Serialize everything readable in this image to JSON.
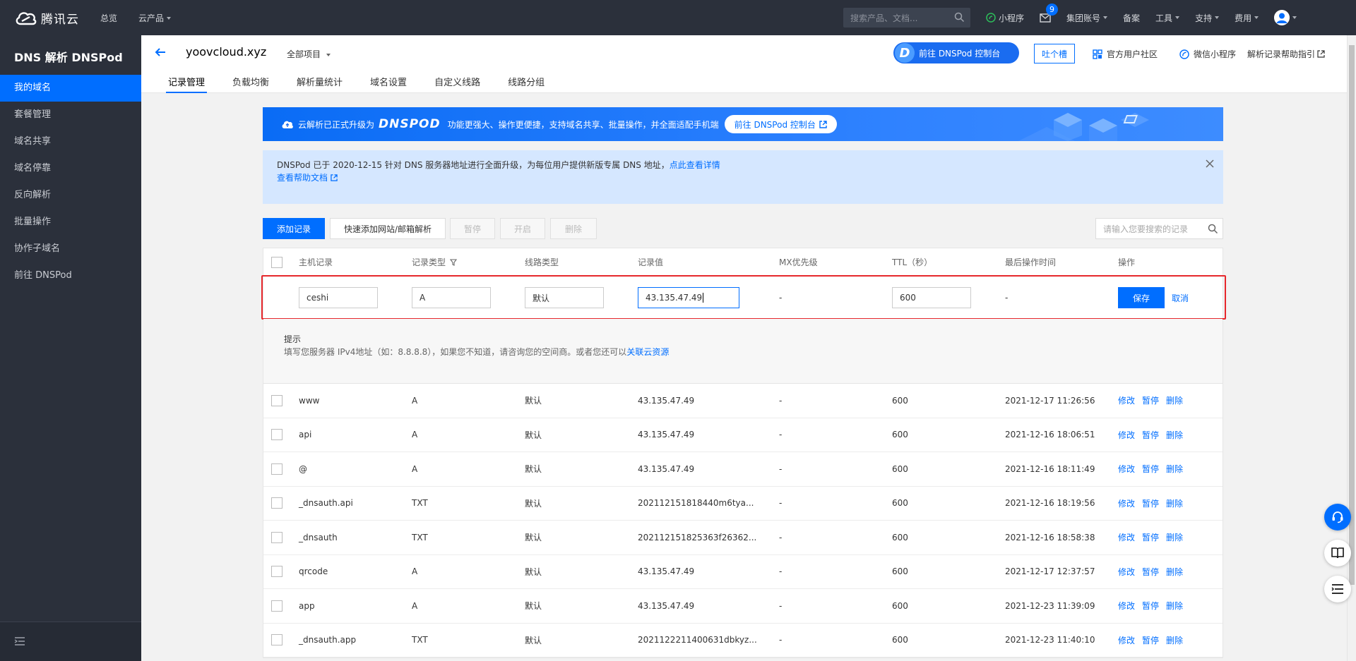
{
  "topnav": {
    "brand": "腾讯云",
    "overview": "总览",
    "products": "云产品",
    "search_placeholder": "搜索产品、文档...",
    "miniprogram": "小程序",
    "message_count": "9",
    "group_account": "集团账号",
    "beian": "备案",
    "tools": "工具",
    "support": "支持",
    "billing": "费用"
  },
  "sidebar": {
    "title": "DNS 解析 DNSPod",
    "items": [
      {
        "label": "我的域名"
      },
      {
        "label": "套餐管理"
      },
      {
        "label": "域名共享"
      },
      {
        "label": "域名停靠"
      },
      {
        "label": "反向解析"
      },
      {
        "label": "批量操作"
      },
      {
        "label": "协作子域名"
      },
      {
        "label": "前往 DNSPod"
      }
    ]
  },
  "header": {
    "domain": "yoovcloud.xyz",
    "project": "全部项目",
    "dnspod_console": "前往 DNSPod 控制台",
    "tucao": "吐个槽",
    "community": "官方用户社区",
    "wechat_mini": "微信小程序",
    "help_guide": "解析记录帮助指引",
    "tabs": [
      {
        "label": "记录管理"
      },
      {
        "label": "负载均衡"
      },
      {
        "label": "解析量统计"
      },
      {
        "label": "域名设置"
      },
      {
        "label": "自定义线路"
      },
      {
        "label": "线路分组"
      }
    ]
  },
  "banner": {
    "text1": "云解析已正式升级为",
    "brand": "DNSPOD",
    "text2": "功能更强大、操作更便捷，支持域名共享、批量操作，并全面适配手机端",
    "button": "前往 DNSPod 控制台"
  },
  "notice": {
    "text": "DNSPod 已于 2020-12-15 针对 DNS 服务器地址进行全面升级，为每位用户提供新版专属 DNS 地址，",
    "link": "点此查看详情",
    "help": "查看帮助文档"
  },
  "toolbar": {
    "add_record": "添加记录",
    "quick_add": "快速添加网站/邮箱解析",
    "pause": "暂停",
    "enable": "开启",
    "delete": "删除",
    "search_placeholder": "请输入您要搜索的记录"
  },
  "table": {
    "columns": [
      "主机记录",
      "记录类型",
      "线路类型",
      "记录值",
      "MX优先级",
      "TTL（秒）",
      "最后操作时间",
      "操作"
    ],
    "edit": {
      "host": "ceshi",
      "type": "A",
      "line": "默认",
      "value": "43.135.47.49",
      "mx": "-",
      "ttl": "600",
      "time": "-",
      "save": "保存",
      "cancel": "取消"
    },
    "hint": {
      "title": "提示",
      "body": "填写您服务器 IPv4地址（如：8.8.8.8），如果您不知道，请咨询您的空间商。或者您还可以",
      "link": "关联云资源"
    },
    "ops": {
      "modify": "修改",
      "pause": "暂停",
      "delete": "删除"
    },
    "rows": [
      {
        "host": "www",
        "type": "A",
        "line": "默认",
        "value": "43.135.47.49",
        "mx": "-",
        "ttl": "600",
        "time": "2021-12-17 11:26:56"
      },
      {
        "host": "api",
        "type": "A",
        "line": "默认",
        "value": "43.135.47.49",
        "mx": "-",
        "ttl": "600",
        "time": "2021-12-16 18:06:51"
      },
      {
        "host": "@",
        "type": "A",
        "line": "默认",
        "value": "43.135.47.49",
        "mx": "-",
        "ttl": "600",
        "time": "2021-12-16 18:11:49"
      },
      {
        "host": "_dnsauth.api",
        "type": "TXT",
        "line": "默认",
        "value": "202112151818440m6tya...",
        "mx": "-",
        "ttl": "600",
        "time": "2021-12-16 18:19:56"
      },
      {
        "host": "_dnsauth",
        "type": "TXT",
        "line": "默认",
        "value": "202112151825363f26362...",
        "mx": "-",
        "ttl": "600",
        "time": "2021-12-16 18:58:38"
      },
      {
        "host": "qrcode",
        "type": "A",
        "line": "默认",
        "value": "43.135.47.49",
        "mx": "-",
        "ttl": "600",
        "time": "2021-12-17 12:37:57"
      },
      {
        "host": "app",
        "type": "A",
        "line": "默认",
        "value": "43.135.47.49",
        "mx": "-",
        "ttl": "600",
        "time": "2021-12-23 11:39:09"
      },
      {
        "host": "_dnsauth.app",
        "type": "TXT",
        "line": "默认",
        "value": "2021122211400631dbkyz...",
        "mx": "-",
        "ttl": "600",
        "time": "2021-12-23 11:40:10"
      }
    ]
  },
  "colors": {
    "nav_bg": "#2b303b",
    "accent": "#006eff",
    "highlight": "#e6272c"
  }
}
